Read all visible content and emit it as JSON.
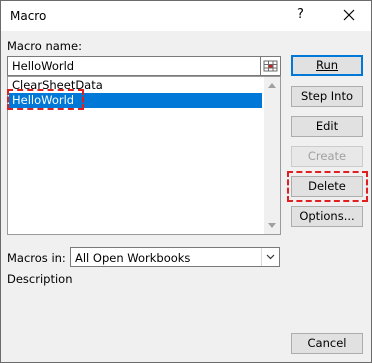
{
  "window": {
    "title": "Macro",
    "help": "?"
  },
  "macro_name": {
    "label": "Macro name:",
    "value": "HelloWorld"
  },
  "macro_list": {
    "items": [
      "ClearSheetData",
      "HelloWorld"
    ],
    "selected": "HelloWorld"
  },
  "buttons": {
    "run": "Run",
    "step_into": "Step Into",
    "edit": "Edit",
    "create": "Create",
    "delete": "Delete",
    "options": "Options...",
    "cancel": "Cancel"
  },
  "macros_in": {
    "label": "Macros in:",
    "value": "All Open Workbooks"
  },
  "description": {
    "label": "Description"
  },
  "colors": {
    "selection": "#0078d7",
    "highlight": "#e02020"
  },
  "icons": {
    "close": "close-icon",
    "range_select": "range-select-icon",
    "dropdown": "chevron-down-icon"
  }
}
